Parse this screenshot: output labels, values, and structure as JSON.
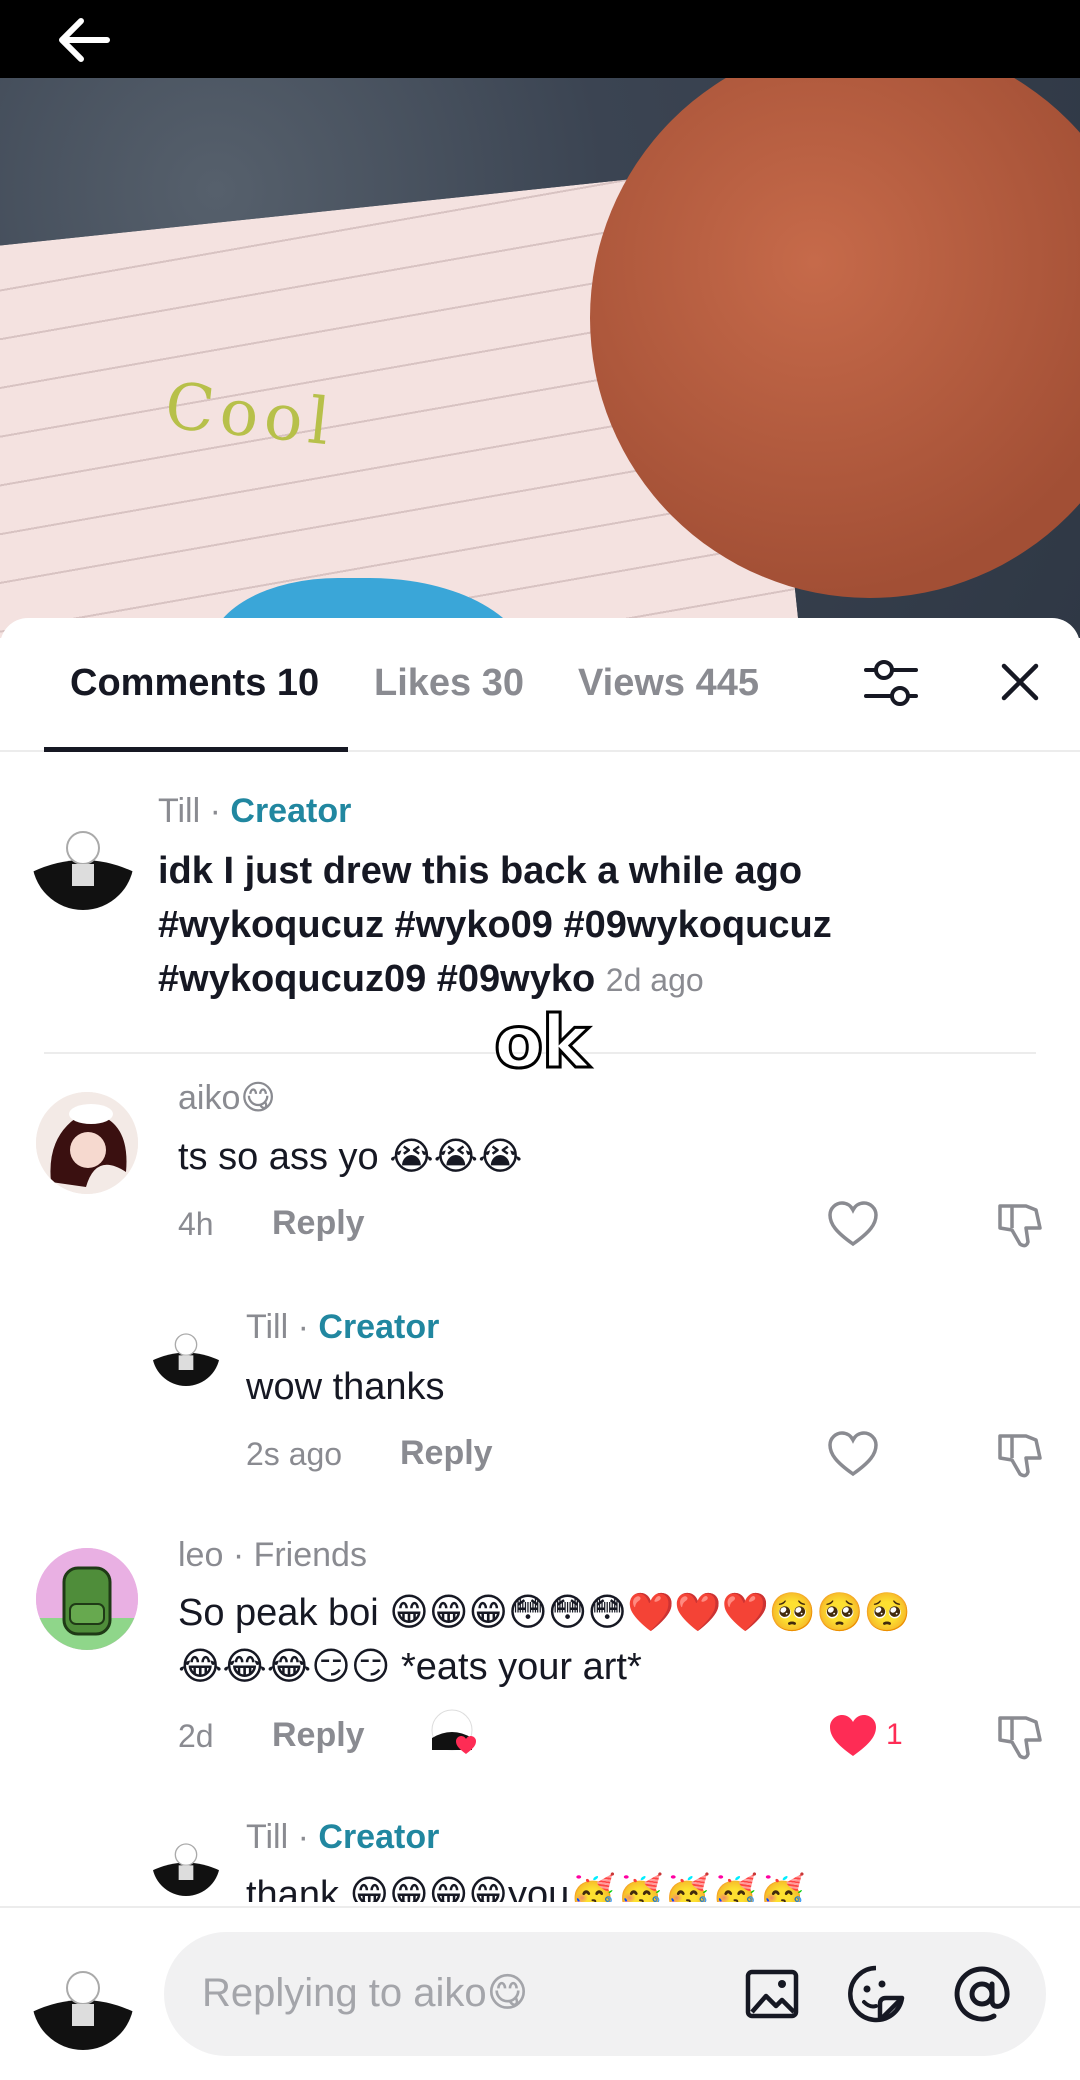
{
  "nav": {
    "back_icon": "arrow-left-icon"
  },
  "video": {
    "handwritten_text": "Cool"
  },
  "overlay": {
    "text": "ok"
  },
  "tabs": [
    {
      "label": "Comments 10",
      "active": true
    },
    {
      "label": "Likes 30",
      "active": false
    },
    {
      "label": "Views 445",
      "active": false
    }
  ],
  "header_icons": {
    "filter": "sliders-icon",
    "close": "close-icon"
  },
  "pinned": {
    "author": "Till",
    "badge": "Creator",
    "separator": " · ",
    "line1": "idk I just drew this back a while ago",
    "line2": "#wykoqucuz #wyko09 #09wykoqucuz",
    "line3": "#wykoqucuz09 #09wyko",
    "time": "2d ago"
  },
  "comments": [
    {
      "author": "aiko😋",
      "text": "ts so ass yo 😭😭😭",
      "time": "4h",
      "reply_label": "Reply"
    },
    {
      "author": "Till",
      "badge": "Creator",
      "separator": " · ",
      "text": "wow thanks",
      "time": "2s ago",
      "reply_label": "Reply"
    },
    {
      "author": "leo · Friends",
      "line1": "So peak boi 😁😁😁😳😳😳❤️❤️❤️🥺🥺🥺",
      "line2": "😂😂😂😏😏 *eats your art*",
      "time": "2d",
      "reply_label": "Reply",
      "likes": "1"
    },
    {
      "author": "Till",
      "badge": "Creator",
      "separator": " · ",
      "text": "thank 😁😁😁😁you🥳🥳🥳🥳🥳"
    }
  ],
  "composer": {
    "placeholder": "Replying to aiko😋",
    "icons": [
      "image-icon",
      "sticker-icon",
      "mention-icon"
    ]
  },
  "colors": {
    "creator": "#2187a0",
    "like_red": "#fe2c55",
    "muted": "#8a8b91",
    "text": "#161823"
  }
}
